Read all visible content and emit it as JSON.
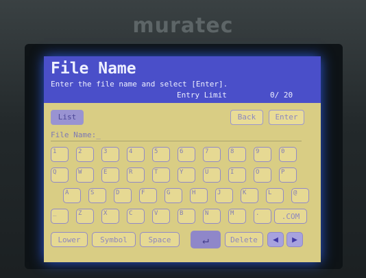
{
  "brand": "muratec",
  "header": {
    "title": "File Name",
    "instruction": "Enter the file name and select [Enter].",
    "entry_limit_label": "Entry Limit",
    "entry_count": "0/ 20"
  },
  "buttons": {
    "list": "List",
    "back": "Back",
    "enter": "Enter",
    "lower": "Lower",
    "symbol": "Symbol",
    "space": "Space",
    "delete": "Delete",
    "com": ".COM"
  },
  "file_name": {
    "label": "File Name:",
    "value": "_"
  },
  "keys": {
    "row1": [
      "1",
      "2",
      "3",
      "4",
      "5",
      "6",
      "7",
      "8",
      "9",
      "0"
    ],
    "row2": [
      "Q",
      "W",
      "E",
      "R",
      "T",
      "Y",
      "U",
      "I",
      "O",
      "P"
    ],
    "row3": [
      "A",
      "S",
      "D",
      "F",
      "G",
      "H",
      "J",
      "K",
      "L",
      "@"
    ],
    "row4": [
      "_",
      "Z",
      "X",
      "C",
      "V",
      "B",
      "N",
      "M",
      "."
    ]
  },
  "icons": {
    "enter": "↵",
    "left": "◀",
    "right": "▶"
  }
}
